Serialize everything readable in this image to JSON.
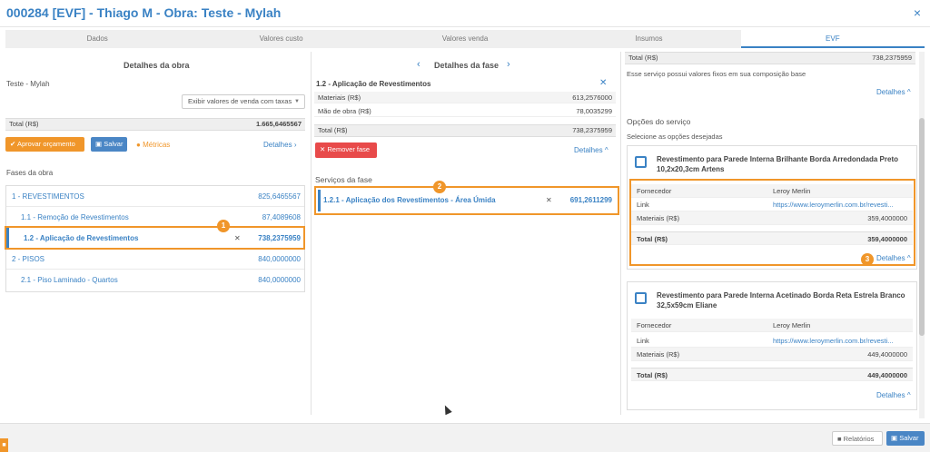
{
  "window": {
    "title": "000284 [EVF] - Thiago M - Obra: Teste - Mylah",
    "close": "×"
  },
  "tabs": [
    "Dados",
    "Valores custo",
    "Valores venda",
    "Insumos",
    "EVF"
  ],
  "left": {
    "header": "Detalhes da obra",
    "obra_name": "Teste - Mylah",
    "select_value": "Exibir valores de venda com taxas",
    "total_label": "Total (R$)",
    "total_value": "1.665,6465567",
    "approve_label": "Aprovar orçamento",
    "save_label": "Salvar",
    "metrics_label": "Métricas",
    "details_label": "Detalhes",
    "phases_title": "Fases da obra",
    "phases": [
      {
        "name": "1 - REVESTIMENTOS",
        "value": "825,6465567"
      },
      {
        "name": "1.1 - Remoção de Revestimentos",
        "value": "87,4089608"
      },
      {
        "name": "1.2 - Aplicação de Revestimentos",
        "value": "738,2375959"
      },
      {
        "name": "2 - PISOS",
        "value": "840,0000000"
      },
      {
        "name": "2.1 - Piso Laminado - Quartos",
        "value": "840,0000000"
      }
    ],
    "marker": "1"
  },
  "middle": {
    "header": "Detalhes da fase",
    "phase_title": "1.2 - Aplicação de Revestimentos",
    "materials_label": "Materiais (R$)",
    "materials_value": "613,2576000",
    "labor_label": "Mão de obra (R$)",
    "labor_value": "78,0035299",
    "total_label": "Total (R$)",
    "total_value": "738,2375959",
    "remove_label": "Remover fase",
    "details_label": "Detalhes",
    "services_title": "Serviços da fase",
    "service_name": "1.2.1 - Aplicação dos Revestimentos - Área Úmida",
    "service_value": "691,2611299",
    "marker": "2"
  },
  "right": {
    "total_label": "Total (R$)",
    "total_value": "738,2375959",
    "fixed_note": "Esse serviço possui valores fixos em sua composição base",
    "details_label": "Detalhes",
    "options_title": "Opções do serviço",
    "options_sub": "Selecione as opções desejadas",
    "marker": "3",
    "cards": [
      {
        "title": "Revestimento para Parede Interna Brilhante Borda Arredondada Preto 10,2x20,3cm Artens",
        "supplier_label": "Fornecedor",
        "supplier": "Leroy Merlin",
        "link_label": "Link",
        "link": "https://www.leroymerlin.com.br/revesti...",
        "materials_label": "Materiais (R$)",
        "materials": "359,4000000",
        "total_label": "Total (R$)",
        "total": "359,4000000",
        "details": "Detalhes"
      },
      {
        "title": "Revestimento para Parede Interna Acetinado Borda Reta Estrela Branco 32,5x59cm Eliane",
        "supplier_label": "Fornecedor",
        "supplier": "Leroy Merlin",
        "link_label": "Link",
        "link": "https://www.leroymerlin.com.br/revesti...",
        "materials_label": "Materiais (R$)",
        "materials": "449,4000000",
        "total_label": "Total (R$)",
        "total": "449,4000000",
        "details": "Detalhes"
      }
    ]
  },
  "footer": {
    "reports_label": "Relatórios",
    "save_label": "Salvar"
  },
  "colors": {
    "accent": "#3a82c4",
    "highlight": "#f0962a",
    "danger": "#e84a4a"
  }
}
